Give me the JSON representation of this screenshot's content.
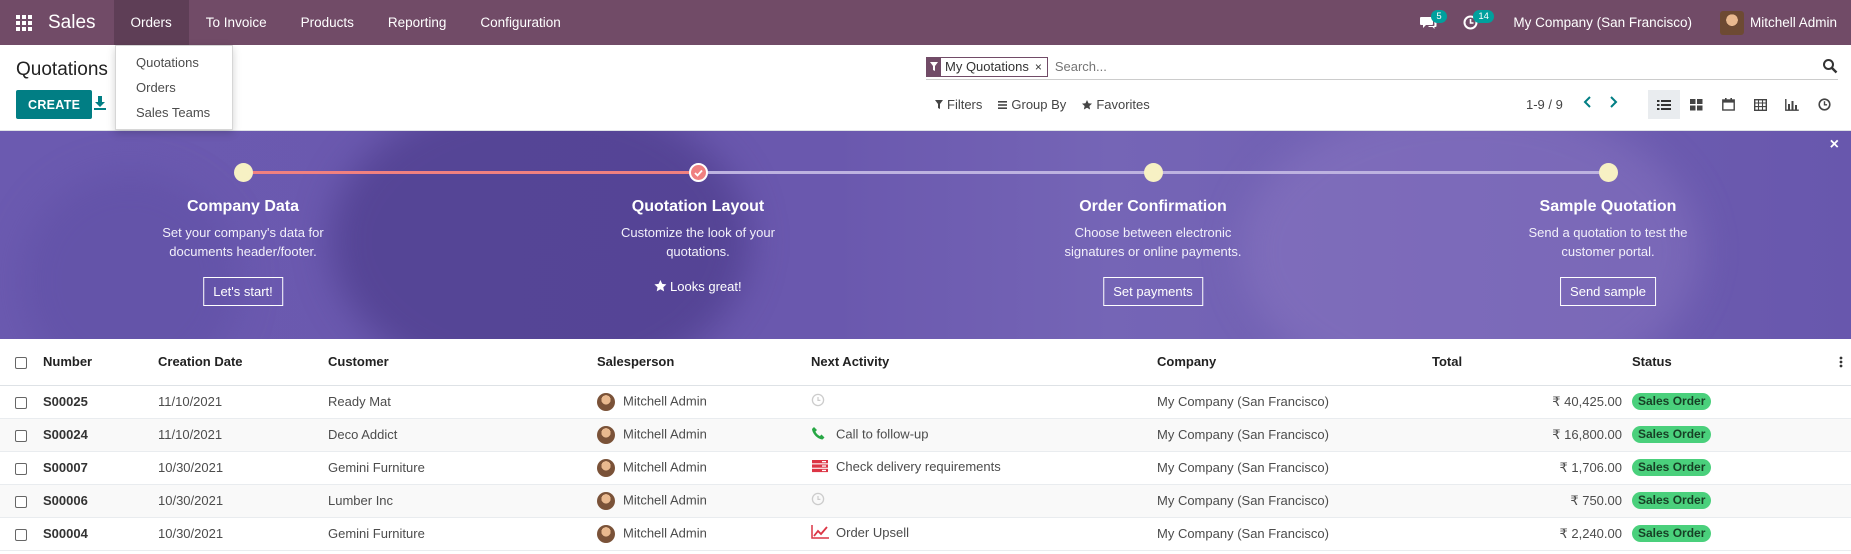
{
  "app": {
    "name": "Sales"
  },
  "nav": {
    "items": [
      {
        "label": "Orders"
      },
      {
        "label": "To Invoice"
      },
      {
        "label": "Products"
      },
      {
        "label": "Reporting"
      },
      {
        "label": "Configuration"
      }
    ]
  },
  "systray": {
    "messages_count": "5",
    "activities_count": "14",
    "company": "My Company (San Francisco)",
    "user": "Mitchell Admin"
  },
  "dropdown": {
    "items": [
      {
        "label": "Quotations"
      },
      {
        "label": "Orders"
      },
      {
        "label": "Sales Teams"
      }
    ]
  },
  "control_panel": {
    "title": "Quotations",
    "create_label": "CREATE",
    "facet": "My Quotations",
    "facet_remove": "×",
    "search_placeholder": "Search...",
    "filters_label": "Filters",
    "groupby_label": "Group By",
    "favorites_label": "Favorites",
    "pager": "1-9 / 9"
  },
  "onboarding": {
    "close": "×",
    "steps": [
      {
        "title": "Company Data",
        "desc": "Set your company's data for documents header/footer.",
        "button": "Let's start!"
      },
      {
        "title": "Quotation Layout",
        "desc": "Customize the look of your quotations.",
        "done_label": "Looks great!"
      },
      {
        "title": "Order Confirmation",
        "desc": "Choose between electronic signatures or online payments.",
        "button": "Set payments"
      },
      {
        "title": "Sample Quotation",
        "desc": "Send a quotation to test the customer portal.",
        "button": "Send sample"
      }
    ]
  },
  "table": {
    "columns": {
      "number": "Number",
      "date": "Creation Date",
      "customer": "Customer",
      "salesperson": "Salesperson",
      "activity": "Next Activity",
      "company": "Company",
      "total": "Total",
      "status": "Status"
    },
    "rows": [
      {
        "number": "S00025",
        "date": "11/10/2021",
        "customer": "Ready Mat",
        "salesperson": "Mitchell Admin",
        "activity": "",
        "activity_icon": "clock-icon",
        "company": "My Company (San Francisco)",
        "total": "₹ 40,425.00",
        "status": "Sales Order"
      },
      {
        "number": "S00024",
        "date": "11/10/2021",
        "customer": "Deco Addict",
        "salesperson": "Mitchell Admin",
        "activity": "Call to follow-up",
        "activity_icon": "phone-icon",
        "company": "My Company (San Francisco)",
        "total": "₹ 16,800.00",
        "status": "Sales Order"
      },
      {
        "number": "S00007",
        "date": "10/30/2021",
        "customer": "Gemini Furniture",
        "salesperson": "Mitchell Admin",
        "activity": "Check delivery requirements",
        "activity_icon": "server-icon",
        "company": "My Company (San Francisco)",
        "total": "₹ 1,706.00",
        "status": "Sales Order"
      },
      {
        "number": "S00006",
        "date": "10/30/2021",
        "customer": "Lumber Inc",
        "salesperson": "Mitchell Admin",
        "activity": "",
        "activity_icon": "clock-icon",
        "company": "My Company (San Francisco)",
        "total": "₹ 750.00",
        "status": "Sales Order"
      },
      {
        "number": "S00004",
        "date": "10/30/2021",
        "customer": "Gemini Furniture",
        "salesperson": "Mitchell Admin",
        "activity": "Order Upsell",
        "activity_icon": "line-chart-icon",
        "company": "My Company (San Francisco)",
        "total": "₹ 2,240.00",
        "status": "Sales Order"
      }
    ]
  },
  "colors": {
    "navbar": "#714b67",
    "primary_button": "#017e84",
    "banner": "#6b5ab0",
    "status_badge": "#4ad07c",
    "badge": "#00a09d"
  }
}
